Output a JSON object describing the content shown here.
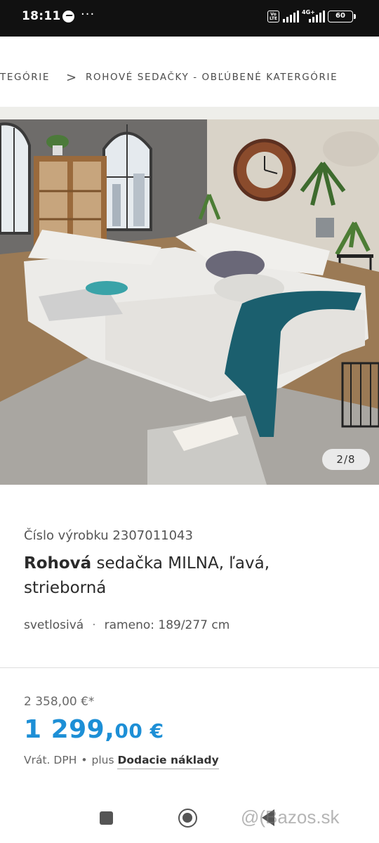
{
  "status_bar": {
    "time": "18:11",
    "more": "···",
    "network": "4G+",
    "battery": "60",
    "icons": [
      "messenger-icon",
      "volte-icon",
      "signal-icon",
      "battery-icon"
    ]
  },
  "breadcrumb": {
    "items": [
      "KATEGÓRIE",
      "ROHOVÉ SEDAČKY - OBĽÚBENÉ KATERGÓRIE"
    ],
    "separator": ">",
    "visible_first": "TEGÓRIE"
  },
  "gallery": {
    "counter": "2/8"
  },
  "product": {
    "number_label": "Číslo výrobku 2307011043",
    "title_bold": "Rohová",
    "title_rest": " sedačka MILNA, ľavá, strieborná",
    "color": "svetlosivá",
    "separator": "·",
    "dimension": "rameno: 189/277 cm"
  },
  "price": {
    "old": "2 358,00 €*",
    "new_whole": "1 299,",
    "new_cents": "00 €",
    "vat": "Vrát. DPH",
    "plus": "plus",
    "shipping_link": "Dodacie náklady"
  },
  "watermark": "@(Bazos.sk",
  "colors": {
    "accent": "#1d8fd6",
    "status_bar_bg": "#111111"
  }
}
